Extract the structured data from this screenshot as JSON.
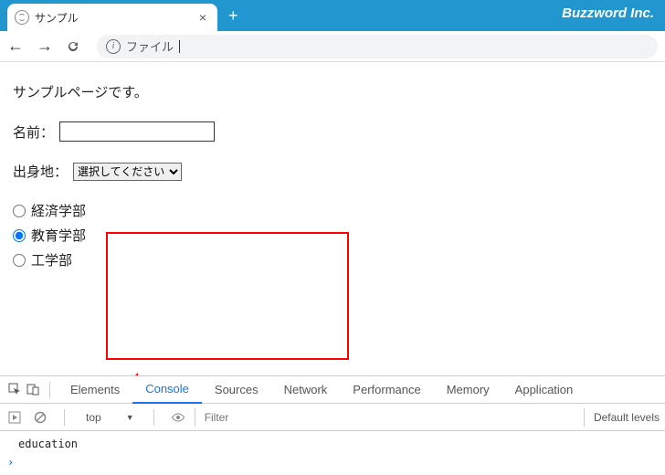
{
  "titlebar": {
    "tab_title": "サンプル",
    "brand": "Buzzword Inc."
  },
  "navbar": {
    "address_label": "ファイル"
  },
  "page": {
    "heading": "サンプルページです。",
    "name_label": "名前：",
    "name_value": "",
    "origin_label": "出身地：",
    "origin_selected": "選択してください",
    "radios": [
      {
        "label": "経済学部",
        "checked": false
      },
      {
        "label": "教育学部",
        "checked": true
      },
      {
        "label": "工学部",
        "checked": false
      }
    ]
  },
  "devtools": {
    "tabs": [
      "Elements",
      "Console",
      "Sources",
      "Network",
      "Performance",
      "Memory",
      "Application"
    ],
    "active_tab": "Console",
    "context": "top",
    "filter_placeholder": "Filter",
    "levels": "Default levels",
    "console_output": "education"
  }
}
